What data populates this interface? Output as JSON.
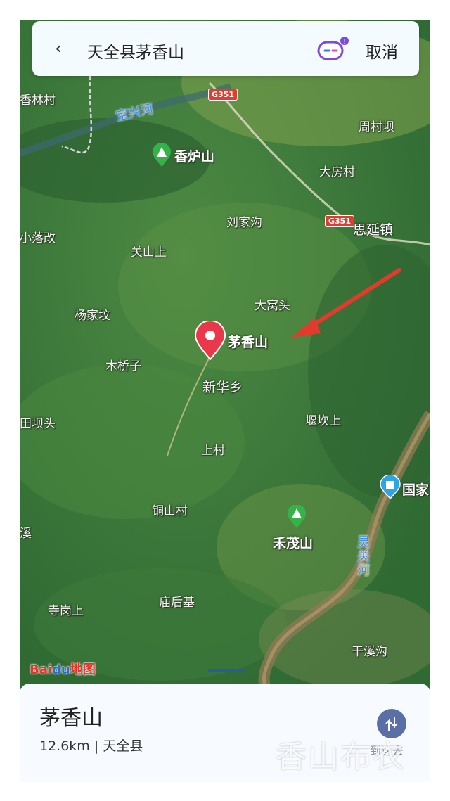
{
  "search": {
    "back": "‹",
    "query": "天全县茅香山",
    "assistant_icon": "robot-assistant-icon",
    "badge": "!",
    "cancel": "取消"
  },
  "map": {
    "places": [
      {
        "key": "xianglinshan",
        "text": "香炉山"
      },
      {
        "key": "heshan",
        "text": "禾茂山"
      },
      {
        "key": "maoxiangshan",
        "text": "茅香山"
      },
      {
        "key": "guojia",
        "text": "国家"
      }
    ],
    "labels": [
      "香林村",
      "宝兴河",
      "周村坝",
      "大房村",
      "刘家沟",
      "思延镇",
      "小落改",
      "关山上",
      "大窝头",
      "杨家坟",
      "木桥子",
      "新华乡",
      "田坝头",
      "堰坎上",
      "上村",
      "铜山村",
      "灵关河",
      "寺岗上",
      "庙后基",
      "干溪沟",
      "溪"
    ],
    "highways": [
      "G351",
      "G351"
    ],
    "accent_red": "#e8384a",
    "poi_green": "#35b34a"
  },
  "card": {
    "name": "茅香山",
    "distance": "12.6km",
    "separator": "|",
    "county": "天全县",
    "nav_label": "到这去"
  },
  "logo": {
    "bai": "Bai",
    "du": "du",
    "map": "地图"
  },
  "watermark": "香山布衣"
}
